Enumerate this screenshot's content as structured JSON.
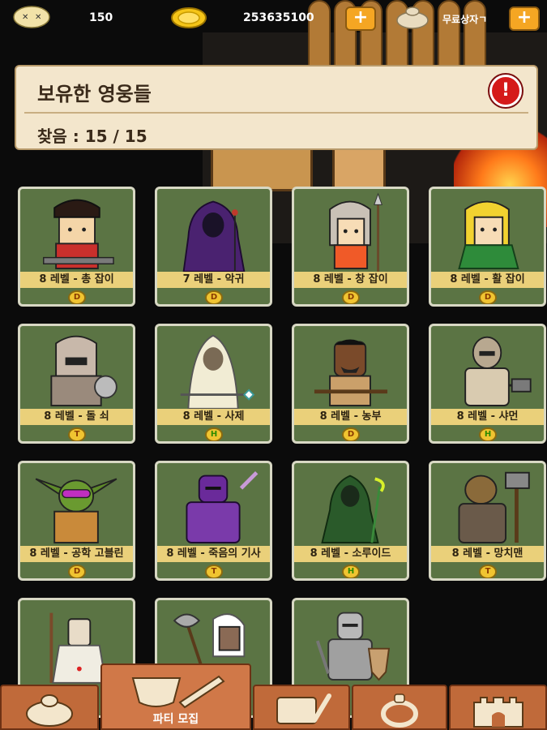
{
  "topbar": {
    "kills": "150",
    "gold": "253635100",
    "free_box_label": "무료상자ㄱ"
  },
  "panel": {
    "title": "보유한 영웅들",
    "found": "찾음 : 15 / 15"
  },
  "heroes": [
    {
      "label": "8 레벨 - 총 잡이",
      "badge": "D",
      "badge_color": "orange"
    },
    {
      "label": "7 레벨 - 악귀",
      "badge": "D",
      "badge_color": "orange"
    },
    {
      "label": "8 레벨 - 창 잡이",
      "badge": "D",
      "badge_color": "orange"
    },
    {
      "label": "8 레벨 - 활 잡이",
      "badge": "D",
      "badge_color": "orange"
    },
    {
      "label": "8 레벨 - 돌 쇠",
      "badge": "T",
      "badge_color": "orange"
    },
    {
      "label": "8 레벨 - 사제",
      "badge": "H",
      "badge_color": "green"
    },
    {
      "label": "8 레벨 - 농부",
      "badge": "D",
      "badge_color": "orange"
    },
    {
      "label": "8 레벨 - 샤먼",
      "badge": "H",
      "badge_color": "green"
    },
    {
      "label": "8 레벨 - 공학 고블린",
      "badge": "D",
      "badge_color": "orange"
    },
    {
      "label": "8 레벨 - 죽음의 기사",
      "badge": "T",
      "badge_color": "orange"
    },
    {
      "label": "8 레벨 - 소루이드",
      "badge": "H",
      "badge_color": "green"
    },
    {
      "label": "8 레벨 - 망치맨",
      "badge": "T",
      "badge_color": "orange"
    },
    {
      "label": "",
      "badge": "",
      "badge_color": ""
    },
    {
      "label": "",
      "badge": "",
      "badge_color": ""
    },
    {
      "label": "",
      "badge": "",
      "badge_color": ""
    }
  ],
  "bottom_nav": {
    "active_label": "파티 모집"
  },
  "colors": {
    "card_bg": "#5b7444",
    "label_bar": "#ead07a",
    "nav_wood": "#c06a3a",
    "accent_orange": "#f5a623"
  }
}
